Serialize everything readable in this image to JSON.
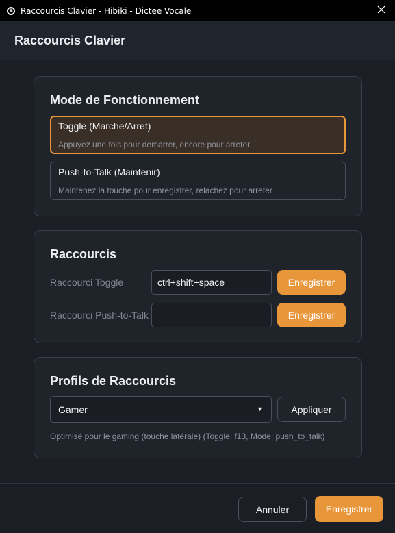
{
  "window": {
    "title": "Raccourcis Clavier - Hibiki - Dictee Vocale"
  },
  "header": {
    "title": "Raccourcis Clavier"
  },
  "mode_section": {
    "title": "Mode de Fonctionnement",
    "options": [
      {
        "label": "Toggle (Marche/Arret)",
        "description": "Appuyez une fois pour demarrer, encore pour arreter",
        "selected": true
      },
      {
        "label": "Push-to-Talk (Maintenir)",
        "description": "Maintenez la touche pour enregistrer, relachez pour arreter",
        "selected": false
      }
    ]
  },
  "shortcuts_section": {
    "title": "Raccourcis",
    "rows": [
      {
        "label": "Raccourci Toggle",
        "value": "ctrl+shift+space",
        "button": "Enregistrer"
      },
      {
        "label": "Raccourci Push-to-Talk",
        "value": "",
        "button": "Enregistrer"
      }
    ]
  },
  "profiles_section": {
    "title": "Profils de Raccourcis",
    "selected_profile": "Gamer",
    "apply_label": "Appliquer",
    "description": "Optimisé pour le gaming (touche latérale) (Toggle: f13, Mode: push_to_talk)"
  },
  "footer": {
    "cancel_label": "Annuler",
    "save_label": "Enregistrer"
  },
  "colors": {
    "accent": "#e8963a",
    "background": "#1b1e24",
    "card": "#1f232a",
    "selected_bg": "#3a2f27"
  },
  "icons": {
    "app": "app-logo-icon",
    "close": "close-icon",
    "dropdown": "chevron-down-icon"
  }
}
